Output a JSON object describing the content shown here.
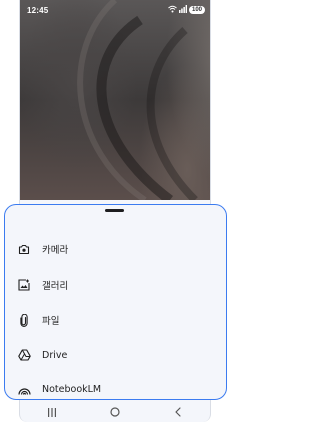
{
  "status_bar": {
    "time": "12:45",
    "battery": "100",
    "icons": [
      "wifi-icon",
      "signal-icon",
      "battery-icon"
    ]
  },
  "sheet": {
    "items": [
      {
        "label": "카메라",
        "icon": "camera-icon"
      },
      {
        "label": "갤러리",
        "icon": "gallery-icon"
      },
      {
        "label": "파일",
        "icon": "paperclip-icon"
      },
      {
        "label": "Drive",
        "icon": "drive-icon"
      },
      {
        "label": "NotebookLM",
        "icon": "notebooklm-icon"
      }
    ]
  },
  "nav_bar": {
    "buttons": [
      "recents-icon",
      "home-icon",
      "back-icon"
    ]
  },
  "colors": {
    "accent": "#3b7bf0",
    "sheet_bg": "#f4f6fb",
    "text": "#1f1f1f"
  }
}
